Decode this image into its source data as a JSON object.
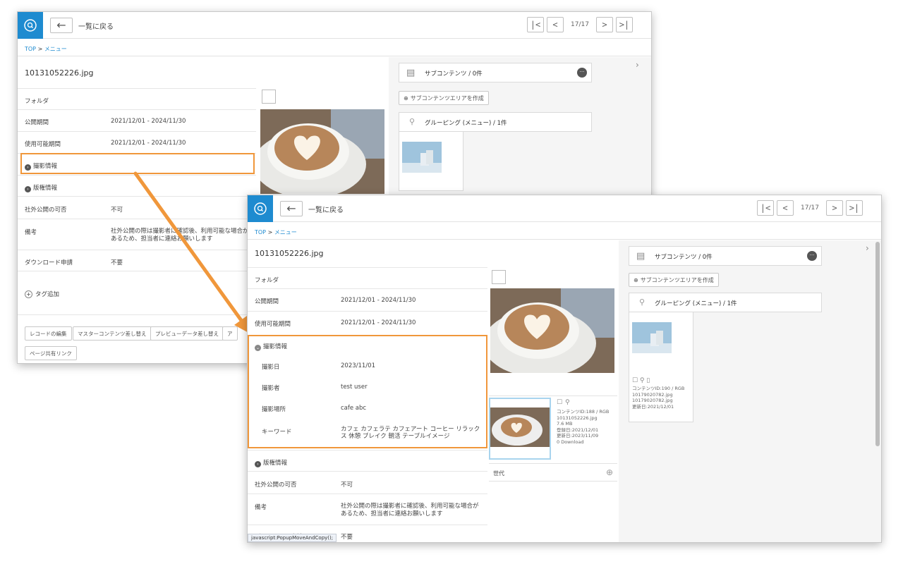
{
  "nav": {
    "back_label": "一覧に戻る",
    "page_count": "17/17"
  },
  "breadcrumb": {
    "top": "TOP",
    "sep": ">",
    "current": "メニュー"
  },
  "file": {
    "name": "10131052226.jpg"
  },
  "fields": {
    "folder": "フォルダ",
    "publish_period_label": "公開期間",
    "publish_period_value": "2021/12/01 - 2024/11/30",
    "usable_period_label": "使用可能期間",
    "usable_period_value": "2021/12/01 - 2024/11/30",
    "shoot_info": "撮影情報",
    "rights_info": "版権情報",
    "external_label": "社外公開の可否",
    "external_value": "不可",
    "note_label": "備考",
    "note_value": "社外公開の際は撮影者に確認後、利用可能な場合があるため、担当者に連絡お願いします",
    "note_value_clipped": "社外公開の際は撮影者に確認後、利用可能な場合があるため、担当者に連絡お願いします",
    "download_label": "ダウンロード申請",
    "download_value": "不要"
  },
  "shoot": {
    "date_label": "撮影日",
    "date_value": "2023/11/01",
    "photographer_label": "撮影者",
    "photographer_value": "test user",
    "location_label": "撮影場所",
    "location_value": "cafe abc",
    "keyword_label": "キーワード",
    "keyword_value": "カフェ カフェラテ カフェアート コーヒー リラックス 休憩 ブレイク 朝活 テーブルイメージ"
  },
  "tags": {
    "add_label": "タグ追加"
  },
  "actions": {
    "edit_record": "レコードの編集",
    "replace_master": "マスターコンテンツ差し替え",
    "replace_preview": "プレビューデータ差し替え",
    "clipped": "ア",
    "share_link": "ページ共有リンク"
  },
  "subcontent": {
    "title": "サブコンテンツ / 0件",
    "create_label": "サブコンテンツエリアを作成",
    "grouping_title": "グルーピング (メニュー) / 1件"
  },
  "version": {
    "label": "世代",
    "meta": [
      "コンテンツID:188 / RGB",
      "10131052226.jpg",
      "7.6 MB",
      "登録日:2021/12/01",
      "更新日:2023/11/09",
      "0 Download"
    ]
  },
  "grouping_item": {
    "meta": [
      "コンテンツID:190 / RGB",
      "10179020782.jpg",
      "10179020782.jpg",
      "更新日:2021/12/01"
    ]
  },
  "status": {
    "text": "javascript:PopupMoveAndCopy();"
  },
  "colors": {
    "accent": "#1e8bd0",
    "highlight": "#f0973b"
  }
}
